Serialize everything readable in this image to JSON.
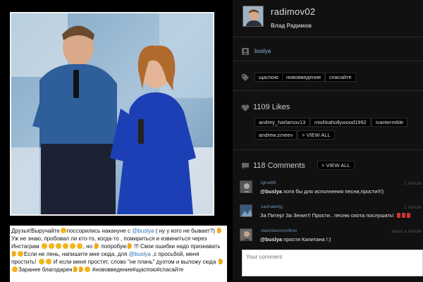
{
  "post": {
    "caption_parts": [
      {
        "t": "Друзья!Выручайте"
      },
      {
        "e": "smile"
      },
      {
        "t": "поссорились накануне с "
      },
      {
        "m": "@buslya"
      },
      {
        "t": " ( ну у кого не бывает?) "
      },
      {
        "e": "hand"
      },
      {
        "t": " Уж не знаю, пробовал ли кто-то, когда-то , помириться и извиниться через Инстаграм "
      },
      {
        "e": "smile"
      },
      {
        "e": "smile"
      },
      {
        "e": "smile"
      },
      {
        "e": "smile"
      },
      {
        "e": "smile"
      },
      {
        "e": "smile"
      },
      {
        "t": ", но "
      },
      {
        "e": "hand"
      },
      {
        "t": " попробую"
      },
      {
        "e": "hand"
      },
      {
        "t": " !!! Свои ошибки надо признавать "
      },
      {
        "e": "hand"
      },
      {
        "e": "smile"
      },
      {
        "t": "Если не лень, напишите мне сюда, для "
      },
      {
        "m": "@buslya"
      },
      {
        "t": " ,с просьбой, меня простить! "
      },
      {
        "e": "smile"
      },
      {
        "e": "smile"
      },
      {
        "t": " И если меня простят, слово \"не плачь\" дуэтом и выложу сюда "
      },
      {
        "e": "hand"
      },
      {
        "e": "smile"
      },
      {
        "t": "Заранее благодарен"
      },
      {
        "e": "hand"
      },
      {
        "e": "hand"
      },
      {
        "e": "smile"
      },
      {
        "t": " #нововведение#щаспою#спасайте"
      }
    ]
  },
  "profile": {
    "username": "radimov02",
    "fullname": "Влад Радимов"
  },
  "tagged": {
    "icon": "person-tag-icon",
    "user": "buslya"
  },
  "tags": {
    "icon": "tag-icon",
    "items": [
      "щаспою",
      "нововведение",
      "спасайте"
    ]
  },
  "likes": {
    "icon": "heart-icon",
    "title": "1109 Likes",
    "users": [
      "andrey_harlamov13",
      "mishkahollywood1992",
      "ivanterreble",
      "andrew.zmeev"
    ],
    "view_all": "> VIEW ALL"
  },
  "comments": {
    "icon": "comment-bubble-icon",
    "title": "118 Comments",
    "view_all": "> VIEW ALL",
    "items": [
      {
        "user": "ignut88",
        "time": "1 minute",
        "mention": "@buslya",
        "text": " хотя бы для исполнения песни,прости!!!)",
        "flags": 0
      },
      {
        "user": "sashabelyj",
        "time": "1 minute",
        "mention": "",
        "text": "За Питер! За Зенит!! Прости.. песню охота послушать! ",
        "flags": 3
      },
      {
        "user": "stanislavmoshkov",
        "time": "about a minute",
        "mention": "@buslya",
        "text": " прости Капитана !:)",
        "flags": 0
      }
    ],
    "input_placeholder": "Your comment"
  },
  "colors": {
    "background_left": "#000000",
    "background_right": "#111111",
    "mention": "#2a6fb3",
    "comment_user": "#6d8fb3"
  }
}
